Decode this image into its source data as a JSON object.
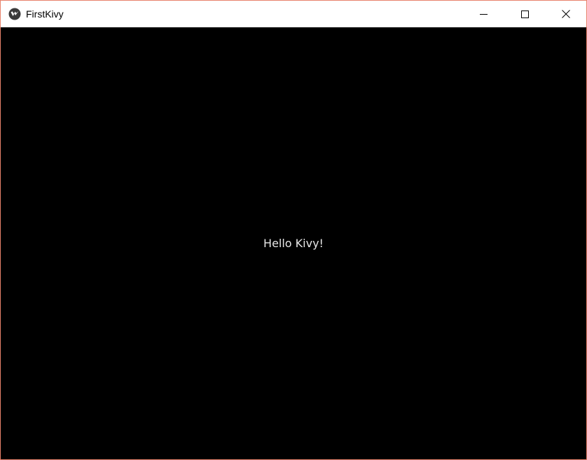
{
  "window": {
    "title": "FirstKivy",
    "app_icon": "kivy-logo-icon",
    "border_color": "#e8826b",
    "titlebar_color": "#ffffff",
    "controls": {
      "minimize_icon": "minimize-icon",
      "maximize_icon": "maximize-icon",
      "close_icon": "close-icon"
    }
  },
  "app": {
    "background_color": "#000000",
    "label_text": "Hello Kivy!",
    "label_color": "#e6e6e6"
  }
}
